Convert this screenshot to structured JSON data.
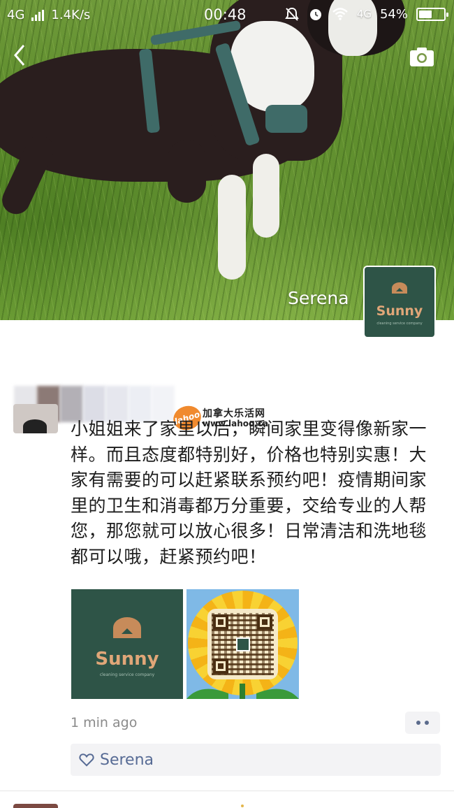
{
  "status_bar": {
    "network": "4G",
    "speed": "1.4K/s",
    "time": "00:48",
    "network_right": "4G",
    "battery": "54%",
    "battery_level": 0.54
  },
  "cover": {
    "owner_name": "Serena"
  },
  "logo": {
    "brand": "Sunny",
    "tagline": "cleaning service company"
  },
  "watermark": {
    "badge": "lahoo",
    "title_cn": "加拿大乐活网",
    "url": "www.lahoo.ca"
  },
  "post": {
    "text": "小姐姐来了家里以后，瞬间家里变得像新家一样。而且态度都特别好，价格也特别实惠！大家有需要的可以赶紧联系预约吧！疫情期间家里的卫生和消毒都万分重要，交给专业的人帮您，那您就可以放心很多！日常清洁和洗地毯都可以哦，赶紧预约吧！",
    "time_ago": "1 min ago",
    "likes": "Serena"
  },
  "colors": {
    "link": "#576b95",
    "logo_bg": "#2e5447",
    "logo_accent": "#d9a070"
  }
}
